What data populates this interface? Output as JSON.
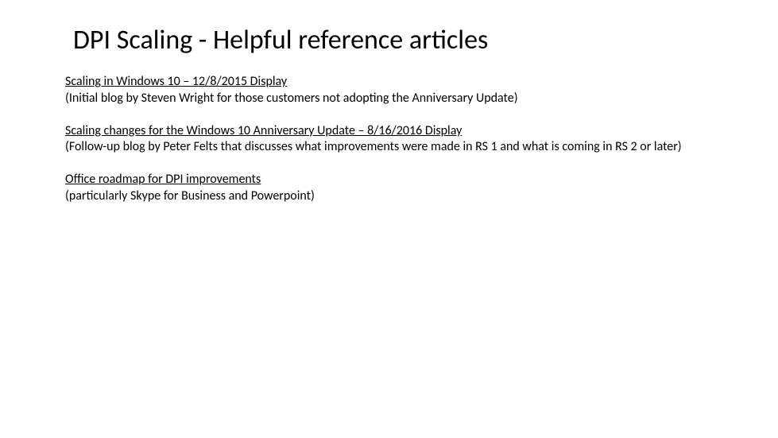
{
  "title": "DPI Scaling - Helpful reference articles",
  "items": [
    {
      "link": "Scaling in Windows 10 – 12/8/2015 Display",
      "desc": "(Initial blog by Steven Wright for those customers not adopting the Anniversary Update)"
    },
    {
      "link": "Scaling changes for the Windows 10 Anniversary Update – 8/16/2016 Display",
      "desc": "(Follow-up blog by Peter Felts that discusses what improvements were made in RS 1 and what is coming in RS 2 or later)"
    },
    {
      "link": "Office roadmap for DPI improvements",
      "desc": "(particularly Skype for Business and Powerpoint)"
    }
  ]
}
